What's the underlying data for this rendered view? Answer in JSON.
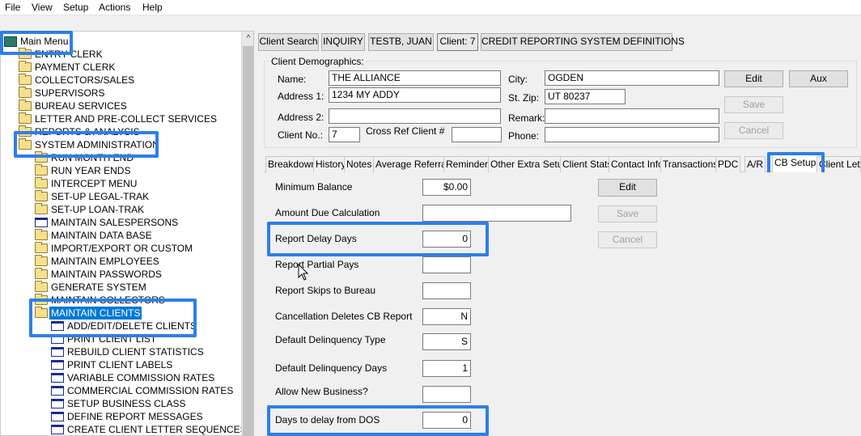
{
  "menubar": [
    "File",
    "View",
    "Setup",
    "Actions",
    "Help"
  ],
  "tree": {
    "root": "Main Menu",
    "items": [
      {
        "label": "ENTRY CLERK",
        "icon": "folder"
      },
      {
        "label": "PAYMENT CLERK",
        "icon": "folder"
      },
      {
        "label": "COLLECTORS/SALES",
        "icon": "folder"
      },
      {
        "label": "SUPERVISORS",
        "icon": "folder"
      },
      {
        "label": "BUREAU SERVICES",
        "icon": "folder"
      },
      {
        "label": "LETTER AND PRE-COLLECT SERVICES",
        "icon": "folder"
      },
      {
        "label": "REPORTS & ANALYSIS",
        "icon": "folder"
      },
      {
        "label": "SYSTEM ADMINISTRATION",
        "icon": "folder-open"
      },
      {
        "label": "RUN MONTH END",
        "icon": "folder"
      },
      {
        "label": "RUN YEAR ENDS",
        "icon": "folder"
      },
      {
        "label": "INTERCEPT MENU",
        "icon": "folder"
      },
      {
        "label": "SET-UP LEGAL-TRAK",
        "icon": "folder"
      },
      {
        "label": "SET-UP LOAN-TRAK",
        "icon": "folder"
      },
      {
        "label": "MAINTAIN SALESPERSONS",
        "icon": "doc"
      },
      {
        "label": "MAINTAIN DATA BASE",
        "icon": "folder"
      },
      {
        "label": "IMPORT/EXPORT OR CUSTOM",
        "icon": "folder"
      },
      {
        "label": "MAINTAIN EMPLOYEES",
        "icon": "folder"
      },
      {
        "label": "MAINTAIN PASSWORDS",
        "icon": "folder"
      },
      {
        "label": "GENERATE SYSTEM",
        "icon": "folder"
      },
      {
        "label": "MAINTAIN COLLECTORS",
        "icon": "folder"
      },
      {
        "label": "MAINTAIN CLIENTS",
        "icon": "folder-open"
      },
      {
        "label": "ADD/EDIT/DELETE CLIENTS",
        "icon": "doc"
      },
      {
        "label": "PRINT CLIENT LIST",
        "icon": "doc"
      },
      {
        "label": "REBUILD CLIENT STATISTICS",
        "icon": "doc"
      },
      {
        "label": "PRINT CLIENT LABELS",
        "icon": "doc"
      },
      {
        "label": "VARIABLE COMMISSION RATES",
        "icon": "doc"
      },
      {
        "label": "COMMERCIAL COMMISSION RATES",
        "icon": "doc"
      },
      {
        "label": "SETUP BUSINESS CLASS",
        "icon": "doc"
      },
      {
        "label": "DEFINE REPORT MESSAGES",
        "icon": "doc"
      },
      {
        "label": "CREATE CLIENT LETTER SEQUENCES",
        "icon": "doc"
      }
    ]
  },
  "top_buttons": [
    "Client Search",
    "INQUIRY",
    "TESTB, JUAN",
    "Client: 7",
    "CREDIT REPORTING SYSTEM DEFINITIONS"
  ],
  "demographics": {
    "group_title": "Client Demographics:",
    "name_label": "Name:",
    "name_value": "THE ALLIANCE",
    "address1_label": "Address 1:",
    "address1_value": "1234 MY ADDY",
    "address2_label": "Address 2:",
    "address2_value": "",
    "clientno_label": "Client No.:",
    "clientno_value": "7",
    "crossref_label": "Cross Ref Client #",
    "crossref_value": "",
    "city_label": "City:",
    "city_value": "OGDEN",
    "stzip_label": "St. Zip:",
    "stzip_value": "UT 80237",
    "remark_label": "Remark:",
    "remark_value": "",
    "phone_label": "Phone:",
    "phone_value": "",
    "edit_button": "Edit",
    "aux_button": "Aux",
    "save_button": "Save",
    "cancel_button": "Cancel"
  },
  "tabs": [
    "Breakdown",
    "History",
    "Notes",
    "Average Referral",
    "Reminders",
    "Other Extra Setup",
    "Client Stats",
    "Contact Info",
    "Transactions",
    "PDC",
    "A/R",
    "CB Setup",
    "Client Letter"
  ],
  "active_tab": "CB Setup",
  "cb_setup": {
    "rows": [
      {
        "label": "Minimum Balance",
        "value": "$0.00"
      },
      {
        "label": "Amount Due Calculation",
        "value": ""
      },
      {
        "label": "Report Delay Days",
        "value": "0"
      },
      {
        "label": "Report Partial Pays",
        "value": ""
      },
      {
        "label": "Report Skips to Bureau",
        "value": ""
      },
      {
        "label": "Cancellation Deletes CB Report",
        "value": "N"
      },
      {
        "label": "Default Delinquency Type",
        "value": "S"
      },
      {
        "label": "Default Delinquency Days",
        "value": "1"
      },
      {
        "label": "Allow New Business?",
        "value": ""
      },
      {
        "label": "Days to delay from DOS",
        "value": "0"
      }
    ],
    "edit_button": "Edit",
    "save_button": "Save",
    "cancel_button": "Cancel"
  },
  "colors": {
    "highlight": "#2d7fe8",
    "selection": "#0078d7"
  }
}
